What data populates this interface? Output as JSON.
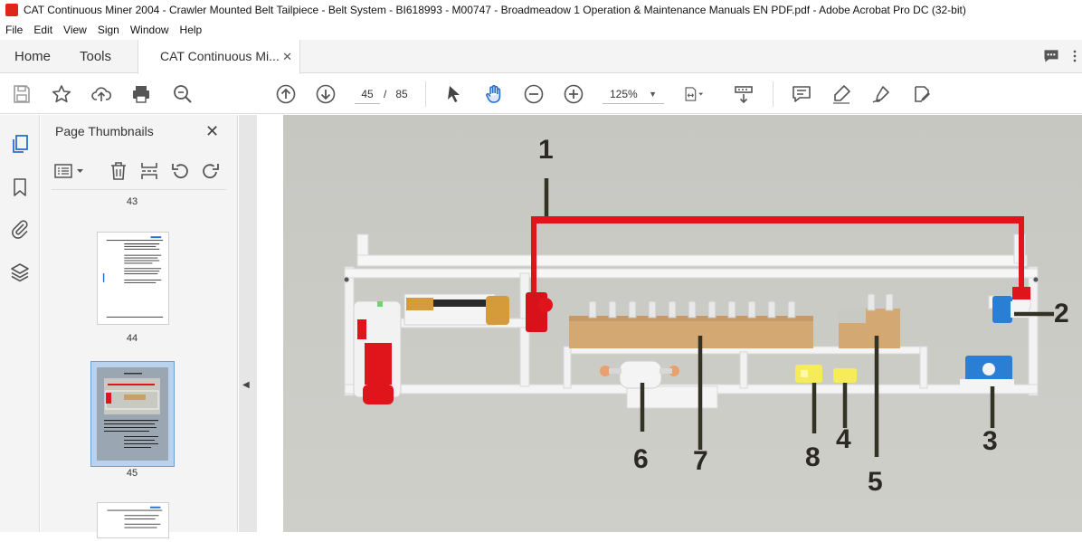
{
  "window": {
    "title": "CAT Continuous Miner 2004 - Crawler Mounted Belt Tailpiece - Belt System - BI618993 - M00747 - Broadmeadow 1 Operation & Maintenance Manuals EN PDF.pdf - Adobe Acrobat Pro DC (32-bit)"
  },
  "menu": [
    "File",
    "Edit",
    "View",
    "Sign",
    "Window",
    "Help"
  ],
  "tabs": {
    "home": "Home",
    "tools": "Tools",
    "document": "CAT Continuous Mi..."
  },
  "toolbar": {
    "current_page": "45",
    "separator": "/",
    "total_pages": "85",
    "zoom": "125%"
  },
  "panel": {
    "title": "Page Thumbnails",
    "thumbnails": [
      {
        "label": "43"
      },
      {
        "label": "44"
      },
      {
        "label": "45",
        "selected": true
      }
    ]
  },
  "figure": {
    "callouts": [
      "1",
      "2",
      "3",
      "4",
      "5",
      "6",
      "7",
      "8"
    ],
    "colors": {
      "frame": "#f2f2f2",
      "red": "#e0151c",
      "brown": "#c9a06a",
      "blue": "#2a7fd4",
      "yellow": "#f2e64a",
      "background": "#c9c9c4"
    }
  },
  "colors": {
    "accent": "#2b6ed1",
    "acrobat_red": "#e0251b"
  }
}
